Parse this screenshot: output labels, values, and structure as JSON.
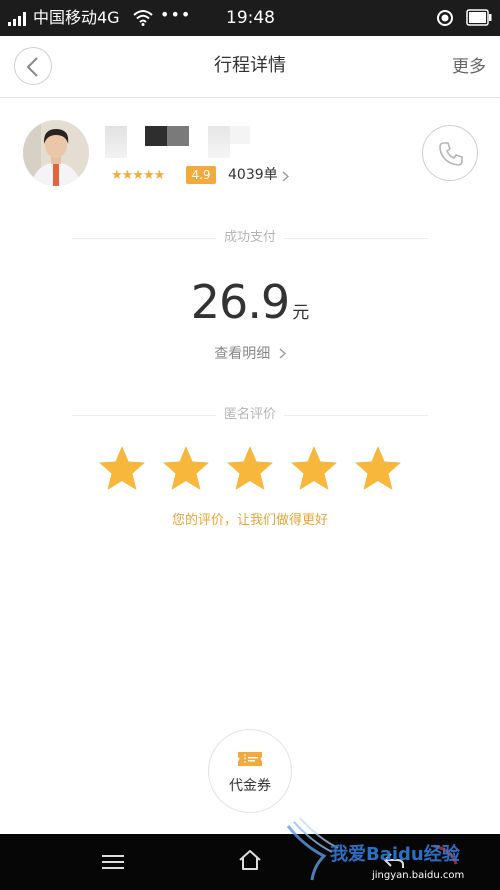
{
  "status_bar": {
    "carrier": "中国移动4G",
    "dots": "•••",
    "time": "19:48",
    "icons": [
      "signal-icon",
      "wifi-icon",
      "location-icon",
      "battery-icon"
    ]
  },
  "header": {
    "title": "行程详情",
    "more_label": "更多",
    "back_icon": "chevron-left-icon"
  },
  "driver": {
    "rating_stars": "★★★★★",
    "rating": "4.9",
    "orders": "4039单",
    "call_icon": "phone-icon"
  },
  "payment": {
    "status_label": "成功支付",
    "amount": "26.9",
    "unit": "元",
    "details_label": "查看明细"
  },
  "review": {
    "section_label": "匿名评价",
    "stars": 5,
    "hint": "您的评价，让我们做得更好"
  },
  "coupon": {
    "label": "代金券",
    "icon": "ticket-icon"
  },
  "watermark": {
    "text": "我爱Baidu经验",
    "url": "jingyan.baidu.com"
  },
  "colors": {
    "accent": "#f3a93c",
    "star": "#f6b73c",
    "status_bar": "#1c1c1c",
    "nav_bar": "#060606"
  }
}
